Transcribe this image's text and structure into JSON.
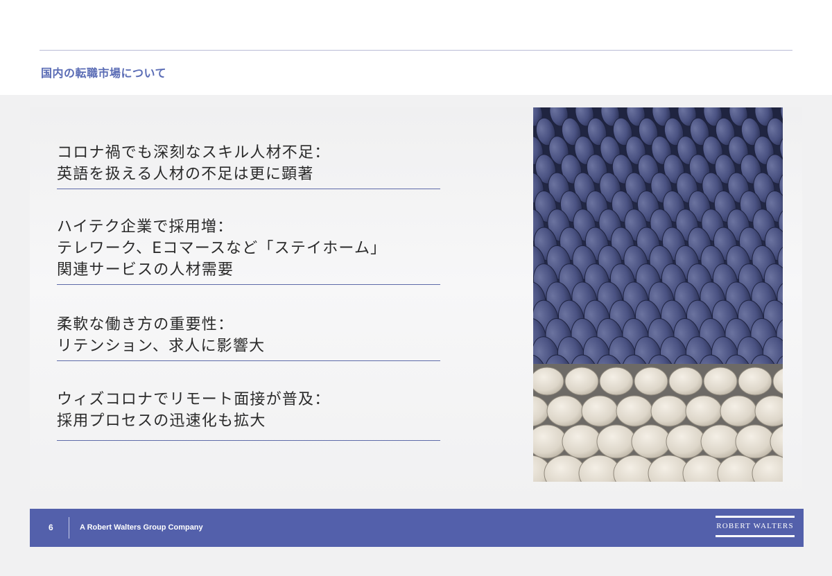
{
  "header": {
    "section_title": "国内の転職市場について"
  },
  "bullets": [
    {
      "lines": [
        "コロナ禍でも深刻なスキル人材不足：",
        "英語を扱える人材の不足は更に顕著"
      ]
    },
    {
      "lines": [
        "ハイテク企業で採用増：",
        "テレワーク、Eコマースなど「ステイホーム」",
        "関連サービスの人材需要"
      ]
    },
    {
      "lines": [
        "柔軟な働き方の重要性：",
        "リテンション、求人に影響大"
      ]
    },
    {
      "lines": [
        "ウィズコロナでリモート面接が普及：",
        "採用プロセスの迅速化も拡大"
      ]
    }
  ],
  "footer": {
    "page_number": "6",
    "company_text": "A Robert Walters Group Company",
    "logo_text": "ROBERT WALTERS"
  },
  "colors": {
    "accent": "#5360ab",
    "title": "#5a6cb5",
    "rule": "#5d6aa8"
  }
}
